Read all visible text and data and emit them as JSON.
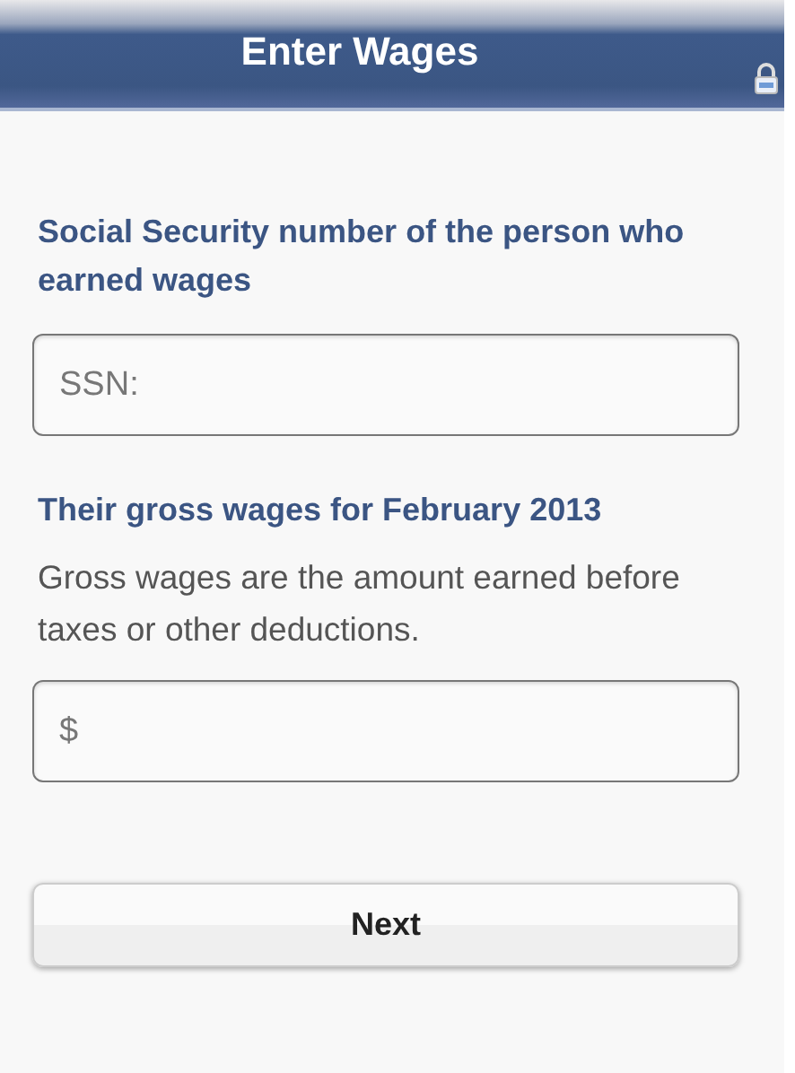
{
  "header": {
    "title": "Enter Wages",
    "locked": true
  },
  "sections": [
    {
      "heading": "Social Security number of the person who earned wages",
      "field": {
        "placeholder": "SSN:"
      }
    },
    {
      "heading": "Their gross wages for February 2013",
      "description": "Gross wages are the amount earned before taxes or other deductions.",
      "field": {
        "placeholder": "$"
      }
    }
  ],
  "buttons": [
    {
      "label": "Next"
    }
  ]
}
